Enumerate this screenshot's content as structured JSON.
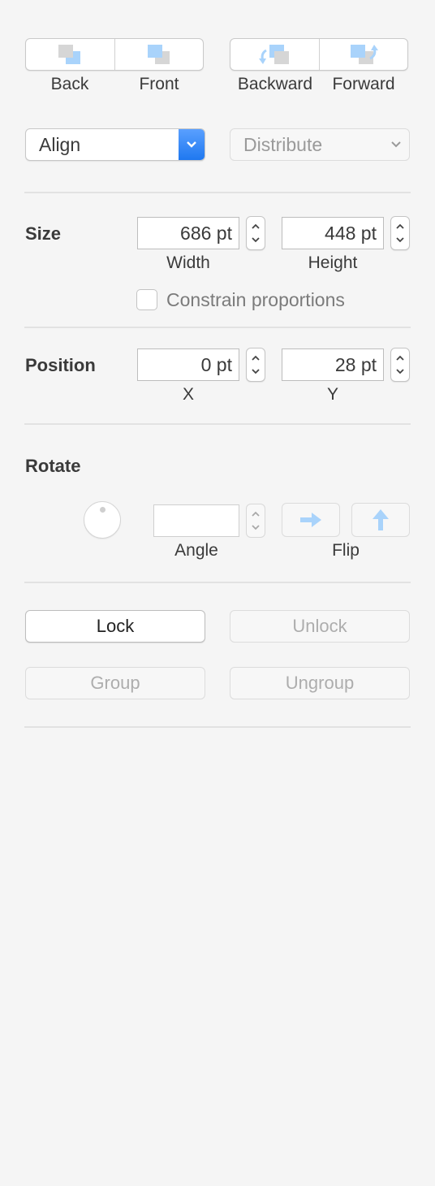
{
  "arrange": {
    "back_label": "Back",
    "front_label": "Front",
    "backward_label": "Backward",
    "forward_label": "Forward"
  },
  "align": {
    "label": "Align"
  },
  "distribute": {
    "label": "Distribute"
  },
  "size": {
    "title": "Size",
    "width_value": "686 pt",
    "width_label": "Width",
    "height_value": "448 pt",
    "height_label": "Height",
    "constrain_label": "Constrain proportions",
    "constrain_checked": false
  },
  "position": {
    "title": "Position",
    "x_value": "0 pt",
    "x_label": "X",
    "y_value": "28 pt",
    "y_label": "Y"
  },
  "rotate": {
    "title": "Rotate",
    "angle_value": "",
    "angle_label": "Angle",
    "flip_label": "Flip"
  },
  "actions": {
    "lock_label": "Lock",
    "unlock_label": "Unlock",
    "group_label": "Group",
    "ungroup_label": "Ungroup"
  },
  "icons": {
    "back": "send-to-back-icon",
    "front": "bring-to-front-icon",
    "backward": "send-backward-icon",
    "forward": "bring-forward-icon",
    "flip_horizontal": "arrow-right-icon",
    "flip_vertical": "arrow-up-icon"
  },
  "colors": {
    "accent": "#1f78f0",
    "icon_blue": "#a9d3fb",
    "icon_gray": "#d6d6d6",
    "panel_bg": "#f5f5f5"
  }
}
